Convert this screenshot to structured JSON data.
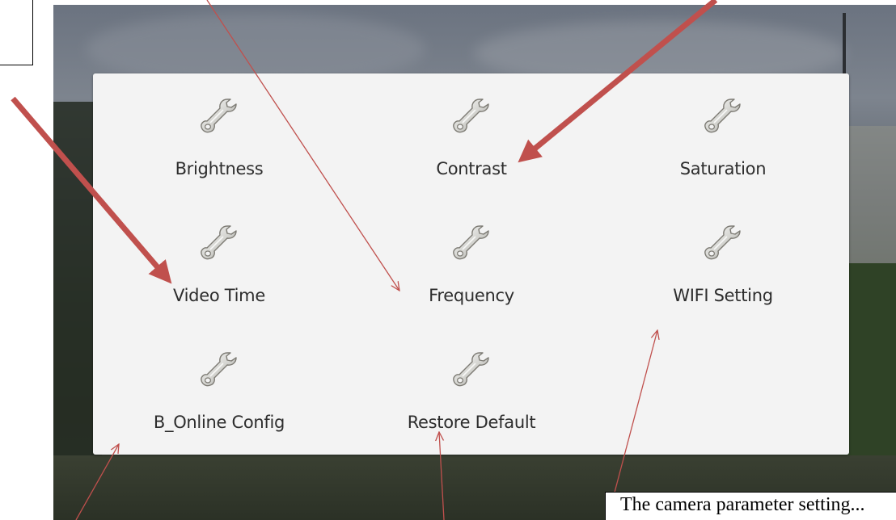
{
  "settings_menu": {
    "items": [
      {
        "label": "Brightness",
        "icon": "wrench-icon"
      },
      {
        "label": "Contrast",
        "icon": "wrench-icon"
      },
      {
        "label": "Saturation",
        "icon": "wrench-icon"
      },
      {
        "label": "Video Time",
        "icon": "wrench-icon"
      },
      {
        "label": "Frequency",
        "icon": "wrench-icon"
      },
      {
        "label": "WIFI Setting",
        "icon": "wrench-icon"
      },
      {
        "label": "B_Online Config",
        "icon": "wrench-icon"
      },
      {
        "label": "Restore Default",
        "icon": "wrench-icon"
      }
    ]
  },
  "annotations": {
    "callout_text": "The camera parameter setting... ",
    "thick_arrow_color": "#c0504d",
    "thin_arrow_color": "#c0504d"
  }
}
